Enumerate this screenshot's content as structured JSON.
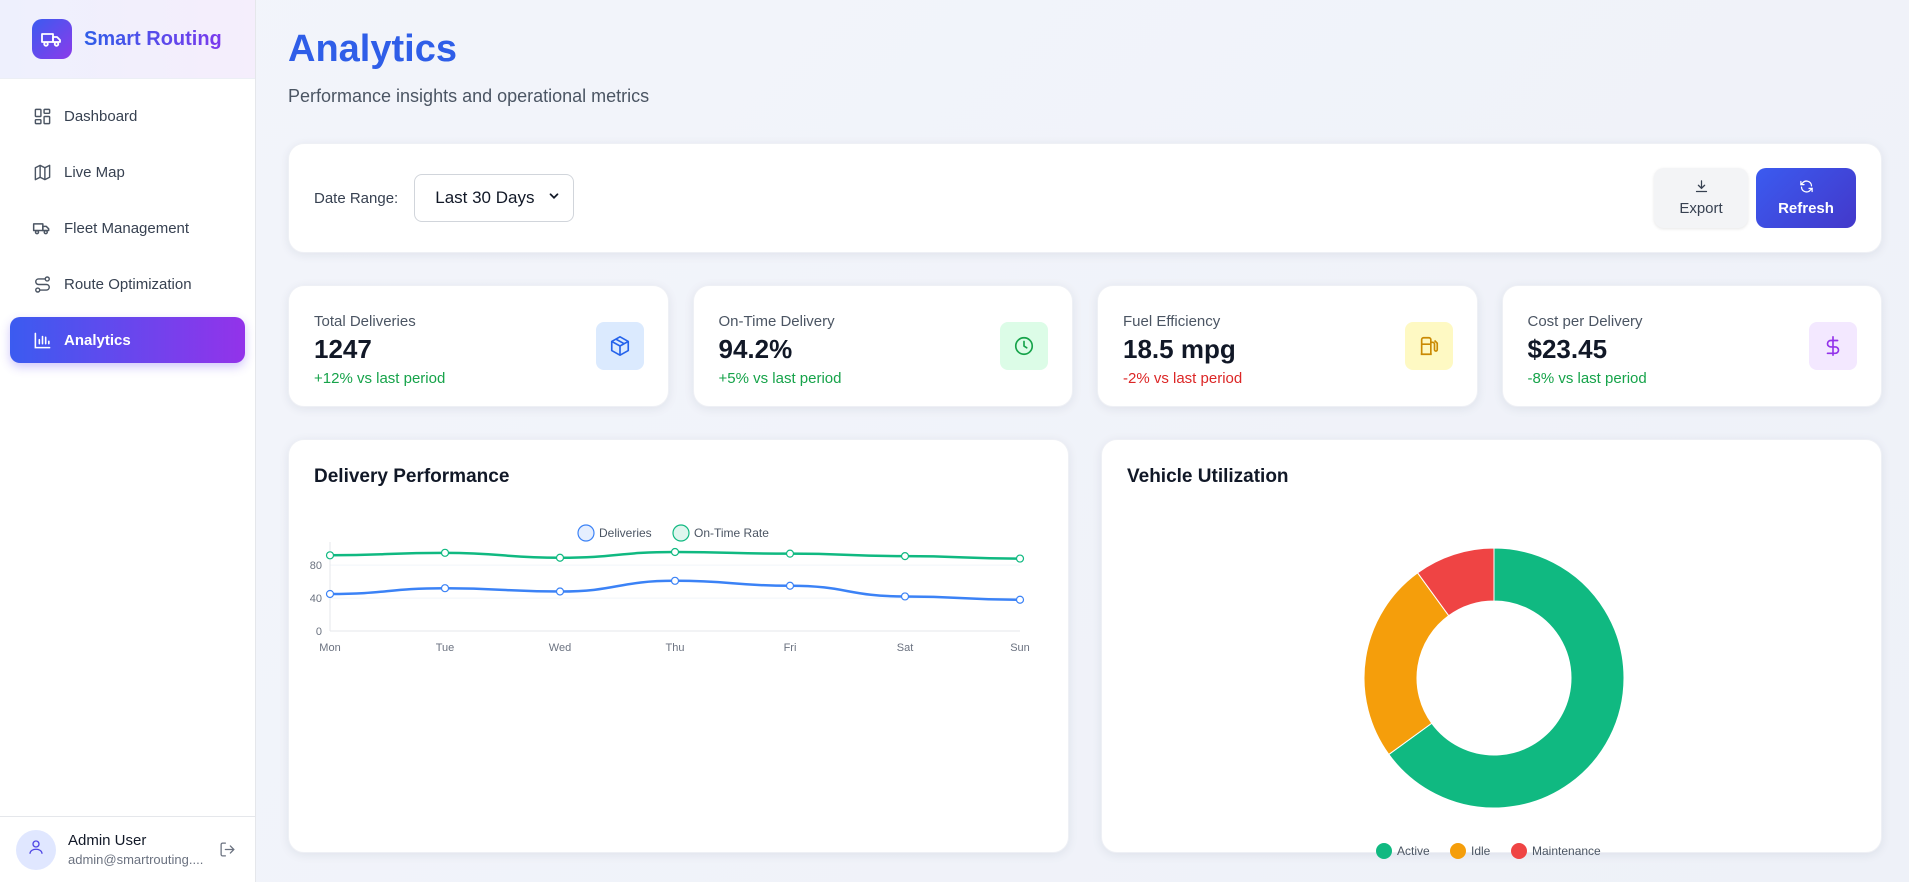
{
  "brand": {
    "name": "Smart Routing"
  },
  "sidebar": {
    "items": [
      {
        "label": "Dashboard",
        "icon": "dashboard-icon",
        "active": false
      },
      {
        "label": "Live Map",
        "icon": "map-icon",
        "active": false
      },
      {
        "label": "Fleet Management",
        "icon": "truck-icon",
        "active": false
      },
      {
        "label": "Route Optimization",
        "icon": "route-icon",
        "active": false
      },
      {
        "label": "Analytics",
        "icon": "bar-chart-icon",
        "active": true
      }
    ]
  },
  "user": {
    "name": "Admin User",
    "email": "admin@smartrouting...."
  },
  "header": {
    "title": "Analytics",
    "subtitle": "Performance insights and operational metrics"
  },
  "filters": {
    "date_range_label": "Date Range:",
    "date_range_value": "Last 30 Days"
  },
  "actions": {
    "export_label": "Export",
    "refresh_label": "Refresh"
  },
  "kpis": [
    {
      "title": "Total Deliveries",
      "value": "1247",
      "delta": "+12% vs last period",
      "trend": "up",
      "icon": "package-icon",
      "icon_bg": "#dbeafe",
      "icon_color": "#2563eb"
    },
    {
      "title": "On-Time Delivery",
      "value": "94.2%",
      "delta": "+5% vs last period",
      "trend": "up",
      "icon": "clock-icon",
      "icon_bg": "#dcfce7",
      "icon_color": "#16a34a"
    },
    {
      "title": "Fuel Efficiency",
      "value": "18.5 mpg",
      "delta": "-2% vs last period",
      "trend": "down",
      "icon": "fuel-icon",
      "icon_bg": "#fef9c3",
      "icon_color": "#ca8a04"
    },
    {
      "title": "Cost per Delivery",
      "value": "$23.45",
      "delta": "-8% vs last period",
      "trend": "up",
      "icon": "dollar-icon",
      "icon_bg": "#f3e8ff",
      "icon_color": "#9333ea"
    }
  ],
  "colors": {
    "accent": "#2f5ee8",
    "positive": "#16a34a",
    "negative": "#dc2626",
    "deliveries": "#3b82f6",
    "on_time": "#10b981",
    "active": "#10b981",
    "idle": "#f59e0b",
    "maintenance": "#ef4444"
  },
  "chart_data": [
    {
      "type": "line",
      "title": "Delivery Performance",
      "categories": [
        "Mon",
        "Tue",
        "Wed",
        "Thu",
        "Fri",
        "Sat",
        "Sun"
      ],
      "series": [
        {
          "name": "Deliveries",
          "values": [
            45,
            52,
            48,
            61,
            55,
            42,
            38
          ]
        },
        {
          "name": "On-Time Rate",
          "values": [
            92,
            95,
            89,
            96,
            94,
            91,
            88
          ]
        }
      ],
      "y_ticks": [
        0,
        40,
        80
      ],
      "ylim": [
        0,
        96
      ],
      "legend": "top",
      "grid": true
    },
    {
      "type": "pie",
      "title": "Vehicle Utilization",
      "labels": [
        "Active",
        "Idle",
        "Maintenance"
      ],
      "values": [
        65,
        25,
        10
      ],
      "legend": "bottom"
    }
  ]
}
